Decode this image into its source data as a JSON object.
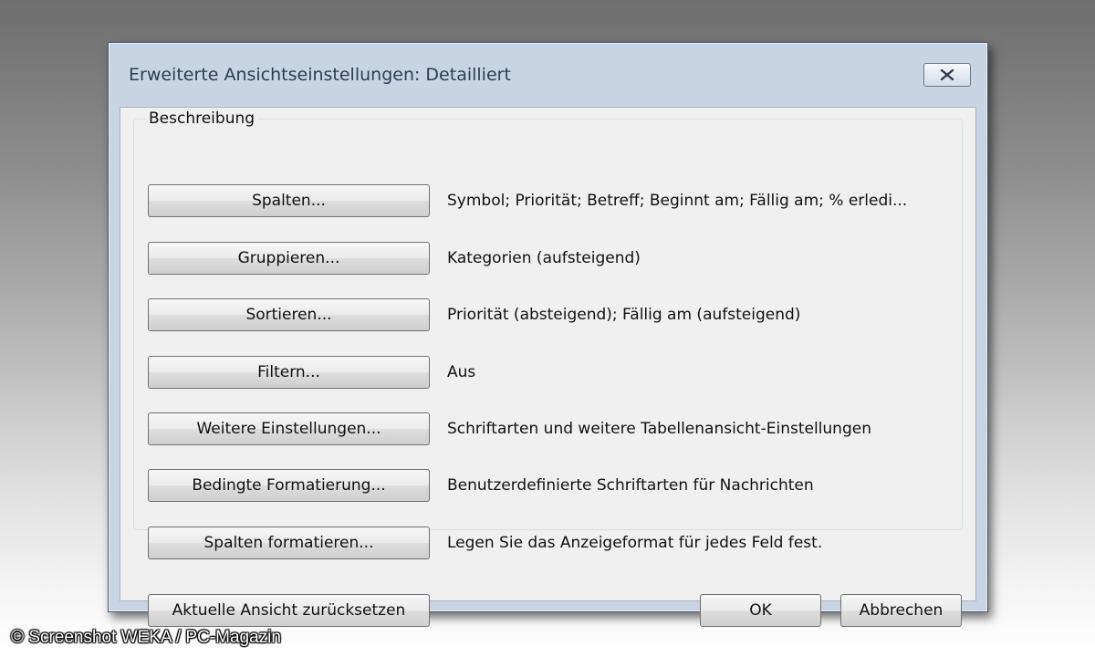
{
  "dialog": {
    "title": "Erweiterte Ansichtseinstellungen: Detailliert",
    "close_icon": "close-icon",
    "group_label": "Beschreibung",
    "rows": [
      {
        "button_label": "Spalten...",
        "description": "Symbol; Priorität; Betreff; Beginnt am; Fällig am; % erledi..."
      },
      {
        "button_label": "Gruppieren...",
        "description": "Kategorien (aufsteigend)"
      },
      {
        "button_label": "Sortieren...",
        "description": "Priorität (absteigend); Fällig am (aufsteigend)"
      },
      {
        "button_label": "Filtern...",
        "description": "Aus"
      },
      {
        "button_label": "Weitere Einstellungen...",
        "description": "Schriftarten und weitere Tabellenansicht-Einstellungen"
      },
      {
        "button_label": "Bedingte Formatierung...",
        "description": "Benutzerdefinierte Schriftarten für Nachrichten"
      },
      {
        "button_label": "Spalten formatieren...",
        "description": "Legen Sie das Anzeigeformat für jedes Feld fest."
      }
    ],
    "reset_label": "Aktuelle Ansicht zurücksetzen",
    "ok_label": "OK",
    "cancel_label": "Abbrechen"
  },
  "watermark": "© Screenshot WEKA / PC-Magazin"
}
